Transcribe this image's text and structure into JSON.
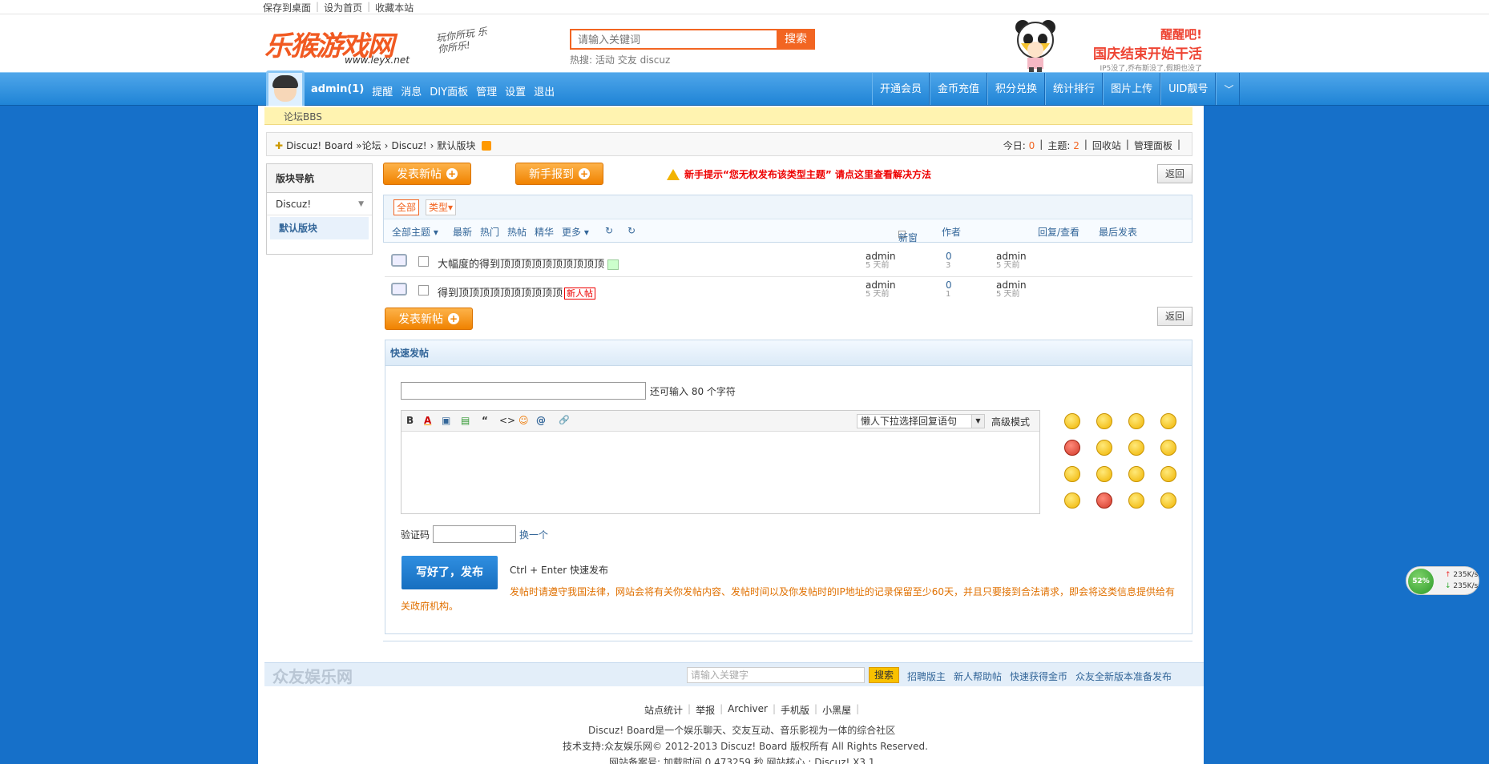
{
  "topbar": {
    "links": [
      "保存到桌面",
      "设为首页",
      "收藏本站"
    ]
  },
  "header": {
    "logo_text": "乐猴游戏网",
    "logo_url": "www.leyx.net",
    "slogan": "玩你所玩 乐你所乐!",
    "search_placeholder": "请输入关键词",
    "search_button": "搜索",
    "hot_label": "热搜:",
    "hot_words": [
      "活动",
      "交友",
      "discuz"
    ],
    "promo_line1": "醒醒吧!",
    "promo_line2a": "国庆结束",
    "promo_line2b": "开始干活",
    "promo_line3": "IP5没了,乔布斯没了,假期也没了"
  },
  "nav": {
    "user": "admin(1)",
    "user_links": [
      "提醒",
      "消息",
      "DIY面板",
      "管理",
      "设置",
      "退出"
    ],
    "right_links": [
      "开通会员",
      "金币充值",
      "积分兑换",
      "统计排行",
      "图片上传",
      "UID靓号"
    ]
  },
  "bbs_label": "论坛BBS",
  "breadcrumb": {
    "parts": [
      "Discuz! Board",
      "»论坛",
      "›",
      "Discuz!",
      "›",
      "默认版块"
    ],
    "today_label": "今日:",
    "today_count": "0",
    "topics_label": "主题:",
    "topics_count": "2",
    "recycle": "回收站",
    "admin_panel": "管理面板"
  },
  "sidebar": {
    "title": "版块导航",
    "group": "Discuz!",
    "current": "默认版块"
  },
  "buttons": {
    "new_post": "发表新帖",
    "newbie": "新手报到",
    "back": "返回"
  },
  "notice": "新手提示“您无权发布该类型主题” 请点这里查看解决方法",
  "filters": {
    "all": "全部",
    "type": "类型▾"
  },
  "list_header": {
    "tabs": [
      "全部主题 ▾",
      "最新",
      "热门",
      "热帖",
      "精华",
      "更多 ▾"
    ],
    "new_window": "新窗",
    "author": "作者",
    "replies_views": "回复/查看",
    "last_post": "最后发表"
  },
  "threads": [
    {
      "title": "大幅度的得到顶顶顶顶顶顶顶顶顶顶",
      "tag": "",
      "author": "admin",
      "author_time": "5 天前",
      "replies": "0",
      "views": "3",
      "last_author": "admin",
      "last_time": "5 天前"
    },
    {
      "title": "得到顶顶顶顶顶顶顶顶顶顶",
      "tag": "新人帖",
      "author": "admin",
      "author_time": "5 天前",
      "replies": "0",
      "views": "1",
      "last_author": "admin",
      "last_time": "5 天前"
    }
  ],
  "fastpost": {
    "title": "快速发帖",
    "subject_hint": "还可输入 80 个字符",
    "toolbar": [
      "B",
      "A",
      "▣",
      "▤",
      "“",
      "<>",
      "☺",
      "@",
      "🔗"
    ],
    "reply_select": "懒人下拉选择回复语句",
    "advanced": "高级模式",
    "captcha_label": "验证码",
    "captcha_switch": "换一个",
    "submit": "写好了，发布",
    "shortcut": "Ctrl + Enter 快速发布",
    "law": "发帖时请遵守我国法律，网站会将有关你发帖内容、发帖时间以及你发帖时的IP地址的记录保留至少60天，并且只要接到合法请求，即会将这类信息提供给有关政府机构。"
  },
  "footer": {
    "logo": "众友娱乐网",
    "search_placeholder": "请输入关键字",
    "search_button": "搜索",
    "links": [
      "招聘版主",
      "新人帮助帖",
      "快速获得金币",
      "众友全新版本准备发布"
    ],
    "nav": [
      "站点统计",
      "举报",
      "Archiver",
      "手机版",
      "小黑屋"
    ],
    "copy1": "Discuz! Board是一个娱乐聊天、交友互动、音乐影视为一体的综合社区",
    "copy2": "技术支持:众友娱乐网© 2012-2013 Discuz! Board 版权所有 All Rights Reserved.",
    "copy3": "网站备案号: 加载时间 0.473259 秒 网站核心 : Discuz! X3.1"
  },
  "netwidget": {
    "percent": "52%",
    "up": "235K/s",
    "down": "235K/s"
  }
}
